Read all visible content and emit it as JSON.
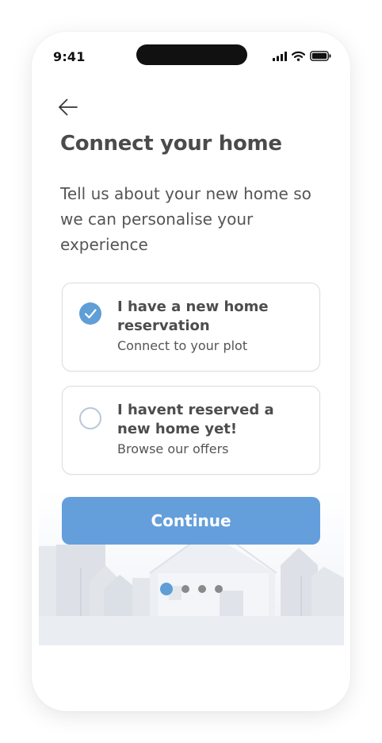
{
  "status_bar": {
    "time": "9:41"
  },
  "header": {
    "title": "Connect your home",
    "subtitle": "Tell us about your new home so we can personalise your experience"
  },
  "options": [
    {
      "title": "I have a new home reservation",
      "subtitle": "Connect to your plot",
      "selected": true
    },
    {
      "title": "I havent reserved a new home yet!",
      "subtitle": "Browse our offers",
      "selected": false
    }
  ],
  "cta": {
    "label": "Continue"
  },
  "pagination": {
    "total": 4,
    "active_index": 0
  },
  "colors": {
    "accent": "#5f9ed6",
    "button": "#649fdb",
    "text": "#4b4b4b"
  },
  "icons": {
    "back": "arrow-left-icon",
    "check": "check-icon",
    "signal": "cellular-signal-icon",
    "wifi": "wifi-icon",
    "battery": "battery-icon"
  }
}
